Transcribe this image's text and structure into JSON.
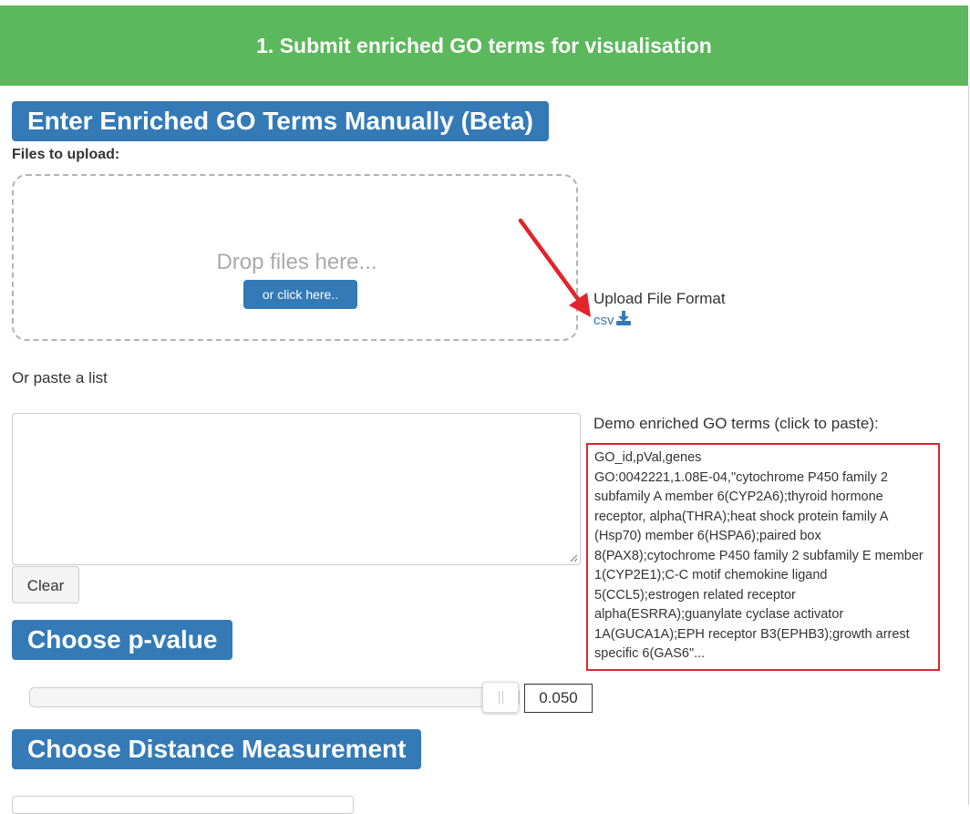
{
  "header": {
    "title": "1. Submit enriched GO terms for visualisation"
  },
  "manual": {
    "title": "Enter Enriched GO Terms Manually (Beta)"
  },
  "upload": {
    "label": "Files to upload:",
    "drop_text": "Drop files here...",
    "click_button": "or click here..",
    "format_label": "Upload File Format",
    "csv_link": "csv"
  },
  "paste": {
    "label": "Or paste a list",
    "textarea_value": "",
    "clear_button": "Clear"
  },
  "demo": {
    "label": "Demo enriched GO terms (click to paste):",
    "lines": [
      "GO_id,pVal,genes",
      "GO:0042221,1.08E-04,\"cytochrome P450 family 2",
      "subfamily A member 6(CYP2A6);thyroid hormone",
      "receptor, alpha(THRA);heat shock protein family A",
      "(Hsp70) member 6(HSPA6);paired box",
      "8(PAX8);cytochrome P450 family 2 subfamily E member",
      "1(CYP2E1);C-C motif chemokine ligand",
      "5(CCL5);estrogen related receptor",
      "alpha(ESRRA);guanylate cyclase activator",
      "1A(GUCA1A);EPH receptor B3(EPHB3);growth arrest",
      "specific 6(GAS6\"..."
    ]
  },
  "pvalue": {
    "title": "Choose p-value",
    "value": "0.050",
    "slider_fraction": 1.0
  },
  "distance": {
    "title": "Choose Distance Measurement"
  },
  "colors": {
    "header_green": "#5cb85c",
    "primary_blue": "#337ab7",
    "highlight_red": "#d9262f"
  },
  "icons": [
    "download-icon",
    "red-arrow-annotation"
  ]
}
